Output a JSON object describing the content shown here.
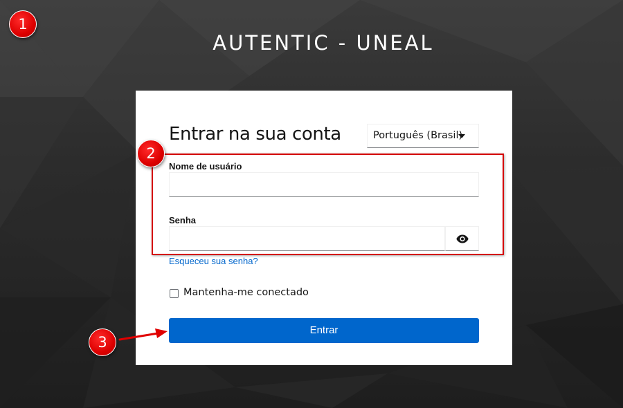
{
  "realm": {
    "title": "AUTENTIC - UNEAL"
  },
  "login": {
    "heading": "Entrar na sua conta",
    "locale": {
      "selected": "Português (Brasil)"
    },
    "username": {
      "label": "Nome de usuário",
      "value": ""
    },
    "password": {
      "label": "Senha",
      "value": ""
    },
    "forgot_password": "Esqueceu sua senha?",
    "remember_me": {
      "label": "Mantenha-me conectado",
      "checked": false
    },
    "submit_label": "Entrar"
  },
  "annotations": [
    {
      "number": "1"
    },
    {
      "number": "2"
    },
    {
      "number": "3"
    }
  ],
  "colors": {
    "primary": "#0066cc",
    "annotation_red": "#dd0000",
    "background_dark": "#2c2c2c"
  },
  "icons": {
    "show_password": "eye-icon",
    "locale_caret": "caret-down-icon"
  }
}
